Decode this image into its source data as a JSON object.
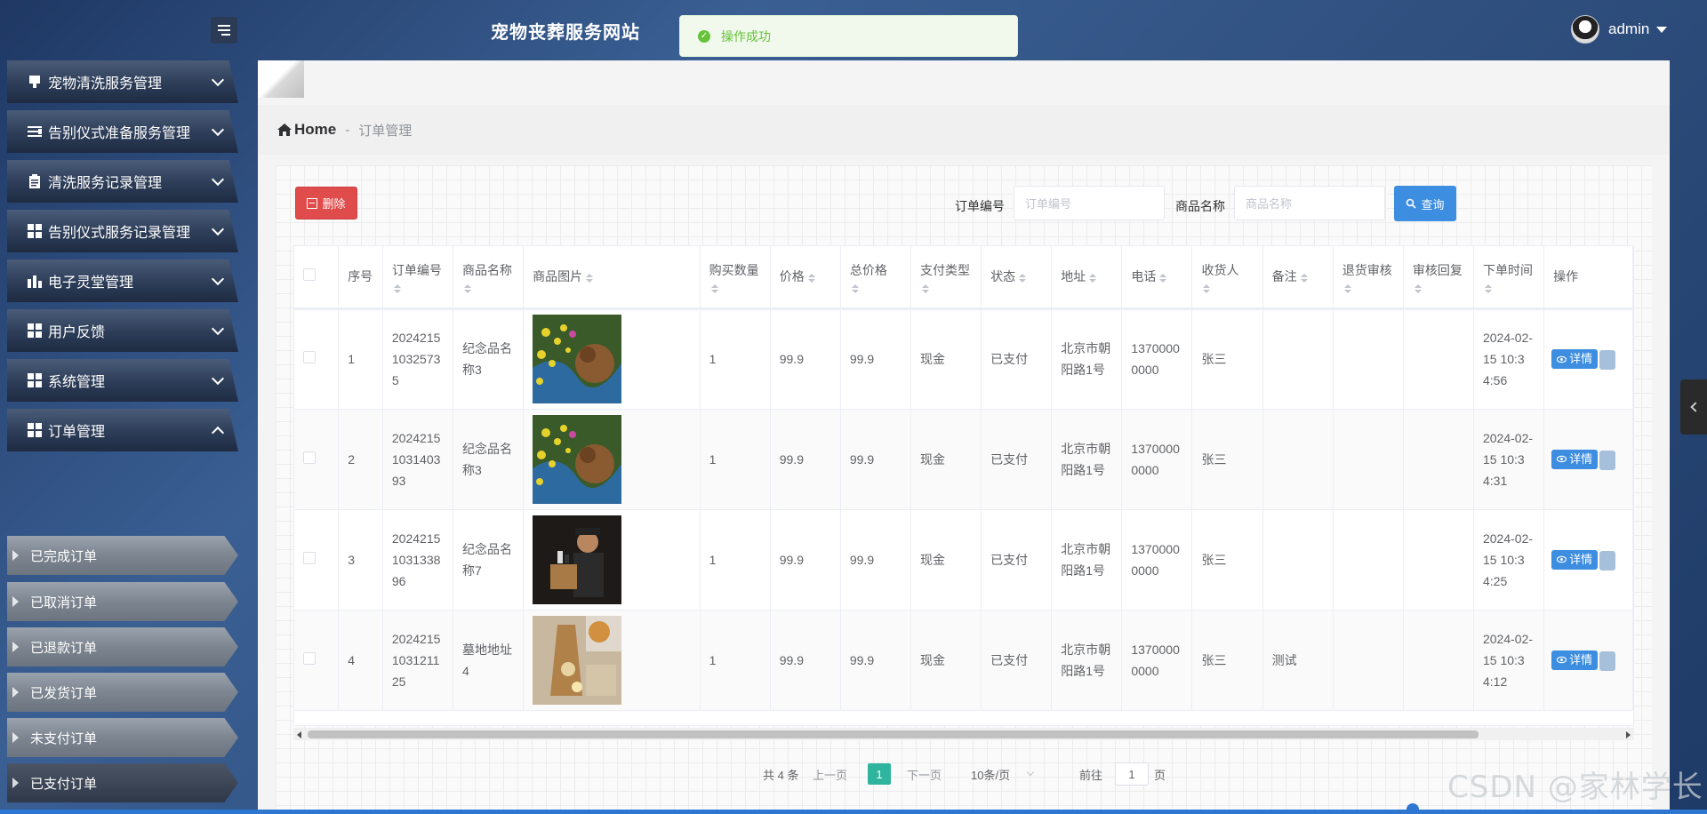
{
  "header": {
    "site_title": "宠物丧葬服务网站",
    "toast_message": "操作成功",
    "username": "admin"
  },
  "sidebar": {
    "menus": [
      {
        "label": "宠物清洗服务管理",
        "icon": "tablet-icon",
        "expanded": false
      },
      {
        "label": "告别仪式准备服务管理",
        "icon": "list-icon",
        "expanded": false
      },
      {
        "label": "清洗服务记录管理",
        "icon": "clipboard-icon",
        "expanded": false
      },
      {
        "label": "告别仪式服务记录管理",
        "icon": "grid-icon",
        "expanded": false
      },
      {
        "label": "电子灵堂管理",
        "icon": "bar-chart-icon",
        "expanded": false
      },
      {
        "label": "用户反馈",
        "icon": "grid-icon",
        "expanded": false
      },
      {
        "label": "系统管理",
        "icon": "grid-icon",
        "expanded": false
      },
      {
        "label": "订单管理",
        "icon": "grid-icon",
        "expanded": true
      }
    ],
    "submenu": [
      {
        "label": "已完成订单"
      },
      {
        "label": "已取消订单"
      },
      {
        "label": "已退款订单"
      },
      {
        "label": "已发货订单"
      },
      {
        "label": "未支付订单"
      },
      {
        "label": "已支付订单",
        "active": true
      }
    ]
  },
  "breadcrumb": {
    "home": "Home",
    "separator": "-",
    "current": "订单管理"
  },
  "toolbar": {
    "delete_label": "删除",
    "order_no_label": "订单编号",
    "order_no_placeholder": "订单编号",
    "product_name_label": "商品名称",
    "product_name_placeholder": "商品名称",
    "query_label": "查询"
  },
  "table": {
    "columns": [
      "序号",
      "订单编号",
      "商品名称",
      "商品图片",
      "购买数量",
      "价格",
      "总价格",
      "支付类型",
      "状态",
      "地址",
      "电话",
      "收货人",
      "备注",
      "退货审核",
      "审核回复",
      "下单时间",
      "操作"
    ],
    "rows": [
      {
        "index": "1",
        "order_no": "20242151032573 5",
        "product": "纪念品名称3",
        "image": "flowers-dog",
        "qty": "1",
        "price": "99.9",
        "total": "99.9",
        "pay_type": "现金",
        "status": "已支付",
        "address": "北京市朝阳路1号",
        "phone": "13700000000",
        "receiver": "张三",
        "remark": "",
        "return_review": "",
        "review_reply": "",
        "time": "2024-02-15 10:34:56",
        "detail_label": "详情"
      },
      {
        "index": "2",
        "order_no": "2024215103140393",
        "product": "纪念品名称3",
        "image": "flowers-dog",
        "qty": "1",
        "price": "99.9",
        "total": "99.9",
        "pay_type": "现金",
        "status": "已支付",
        "address": "北京市朝阳路1号",
        "phone": "13700000000",
        "receiver": "张三",
        "remark": "",
        "return_review": "",
        "review_reply": "",
        "time": "2024-02-15 10:34:31",
        "detail_label": "详情"
      },
      {
        "index": "3",
        "order_no": "2024215103133896",
        "product": "纪念品名称7",
        "image": "man-dog-memorial",
        "qty": "1",
        "price": "99.9",
        "total": "99.9",
        "pay_type": "现金",
        "status": "已支付",
        "address": "北京市朝阳路1号",
        "phone": "13700000000",
        "receiver": "张三",
        "remark": "",
        "return_review": "",
        "review_reply": "",
        "time": "2024-02-15 10:34:25",
        "detail_label": "详情"
      },
      {
        "index": "4",
        "order_no": "2024215103121125",
        "product": "墓地地址4",
        "image": "dog-urn-candle",
        "qty": "1",
        "price": "99.9",
        "total": "99.9",
        "pay_type": "现金",
        "status": "已支付",
        "address": "北京市朝阳路1号",
        "phone": "13700000000",
        "receiver": "张三",
        "remark": "测试",
        "return_review": "",
        "review_reply": "",
        "time": "2024-02-15 10:34:12",
        "detail_label": "详情"
      }
    ]
  },
  "pagination": {
    "total": "共 4 条",
    "prev": "上一页",
    "current_page": "1",
    "next": "下一页",
    "page_size": "10条/页",
    "goto_prefix": "前往",
    "goto_value": "1",
    "goto_suffix": "页"
  },
  "watermark": "CSDN @家林学长",
  "colors": {
    "primary": "#3d8ee0",
    "danger": "#e04b4b",
    "success": "#67c23a",
    "pager_active": "#2fb59d"
  }
}
